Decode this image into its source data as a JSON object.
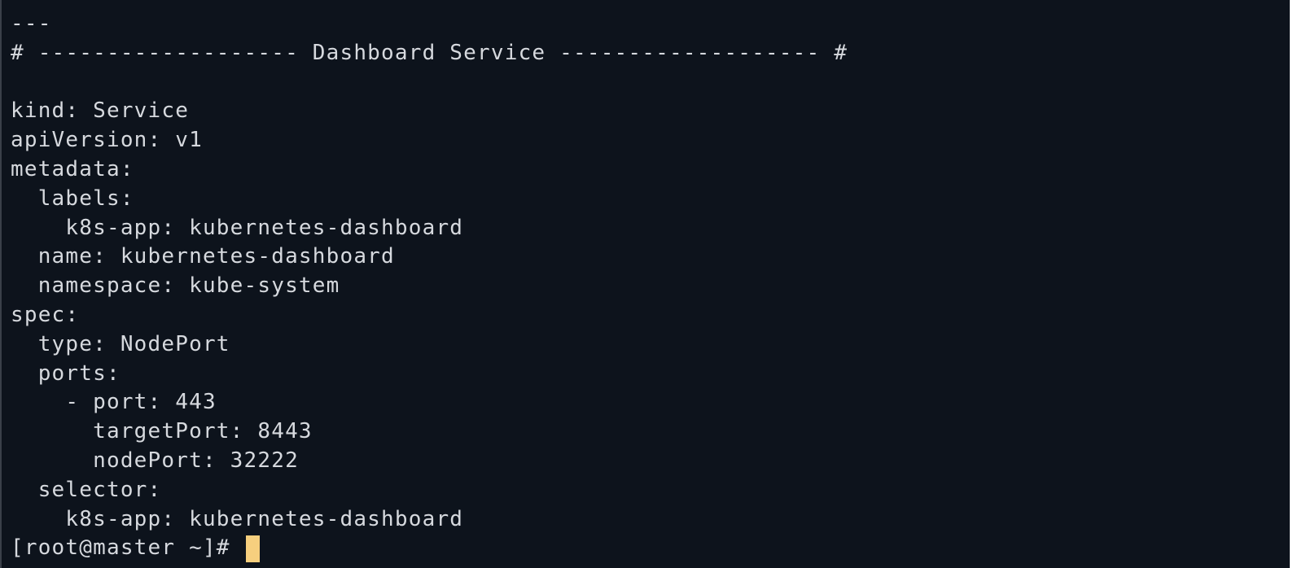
{
  "terminal": {
    "lines": [
      "---",
      "# ------------------- Dashboard Service ------------------- #",
      "",
      "kind: Service",
      "apiVersion: v1",
      "metadata:",
      "  labels:",
      "    k8s-app: kubernetes-dashboard",
      "  name: kubernetes-dashboard",
      "  namespace: kube-system",
      "spec:",
      "  type: NodePort",
      "  ports:",
      "    - port: 443",
      "      targetPort: 8443",
      "      nodePort: 32222",
      "  selector:",
      "    k8s-app: kubernetes-dashboard"
    ],
    "prompt": "[root@master ~]# ",
    "cursor_color": "#f6cf7e",
    "background_color": "#0d131c",
    "text_color": "#d6d9de"
  }
}
